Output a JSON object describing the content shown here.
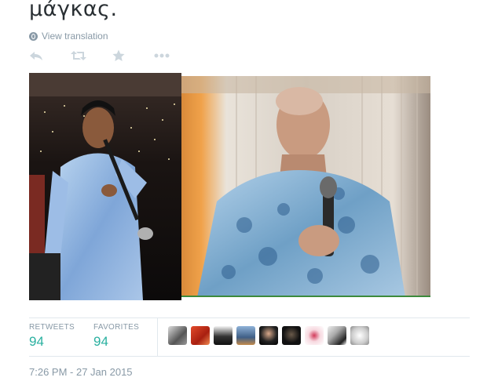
{
  "tweet": {
    "text": "μάγκας.",
    "view_translation": "View translation",
    "timestamp": "7:26 PM - 27 Jan 2015"
  },
  "actions": [
    {
      "name": "reply-icon"
    },
    {
      "name": "retweet-icon"
    },
    {
      "name": "favorite-icon"
    },
    {
      "name": "more-icon"
    }
  ],
  "stats": {
    "retweets_label": "RETWEETS",
    "retweets_value": "94",
    "favorites_label": "FAVORITES",
    "favorites_value": "94"
  },
  "colors": {
    "accent": "#2ab0a0",
    "muted": "#8899a6",
    "border": "#e1e8ed"
  }
}
